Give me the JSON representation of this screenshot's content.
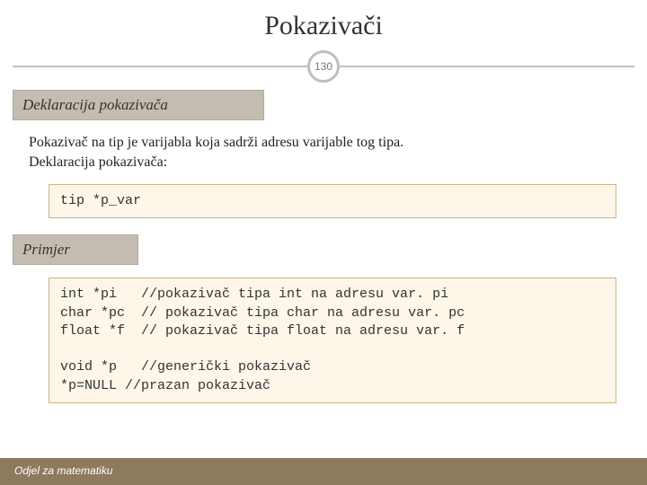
{
  "title": "Pokazivači",
  "page_number": "130",
  "section1": "Deklaracija pokazivača",
  "body_line1": "Pokazivač na tip je varijabla koja sadrži adresu varijable tog tipa.",
  "body_line2": "Deklaracija pokazivača:",
  "code1": "tip *p_var",
  "section2": "Primjer",
  "code2": "int *pi   //pokazivač tipa int na adresu var. pi\nchar *pc  // pokazivač tipa char na adresu var. pc\nfloat *f  // pokazivač tipa float na adresu var. f\n\nvoid *p   //generički pokazivač\n*p=NULL //prazan pokazivač",
  "footer": "Odjel za matematiku"
}
